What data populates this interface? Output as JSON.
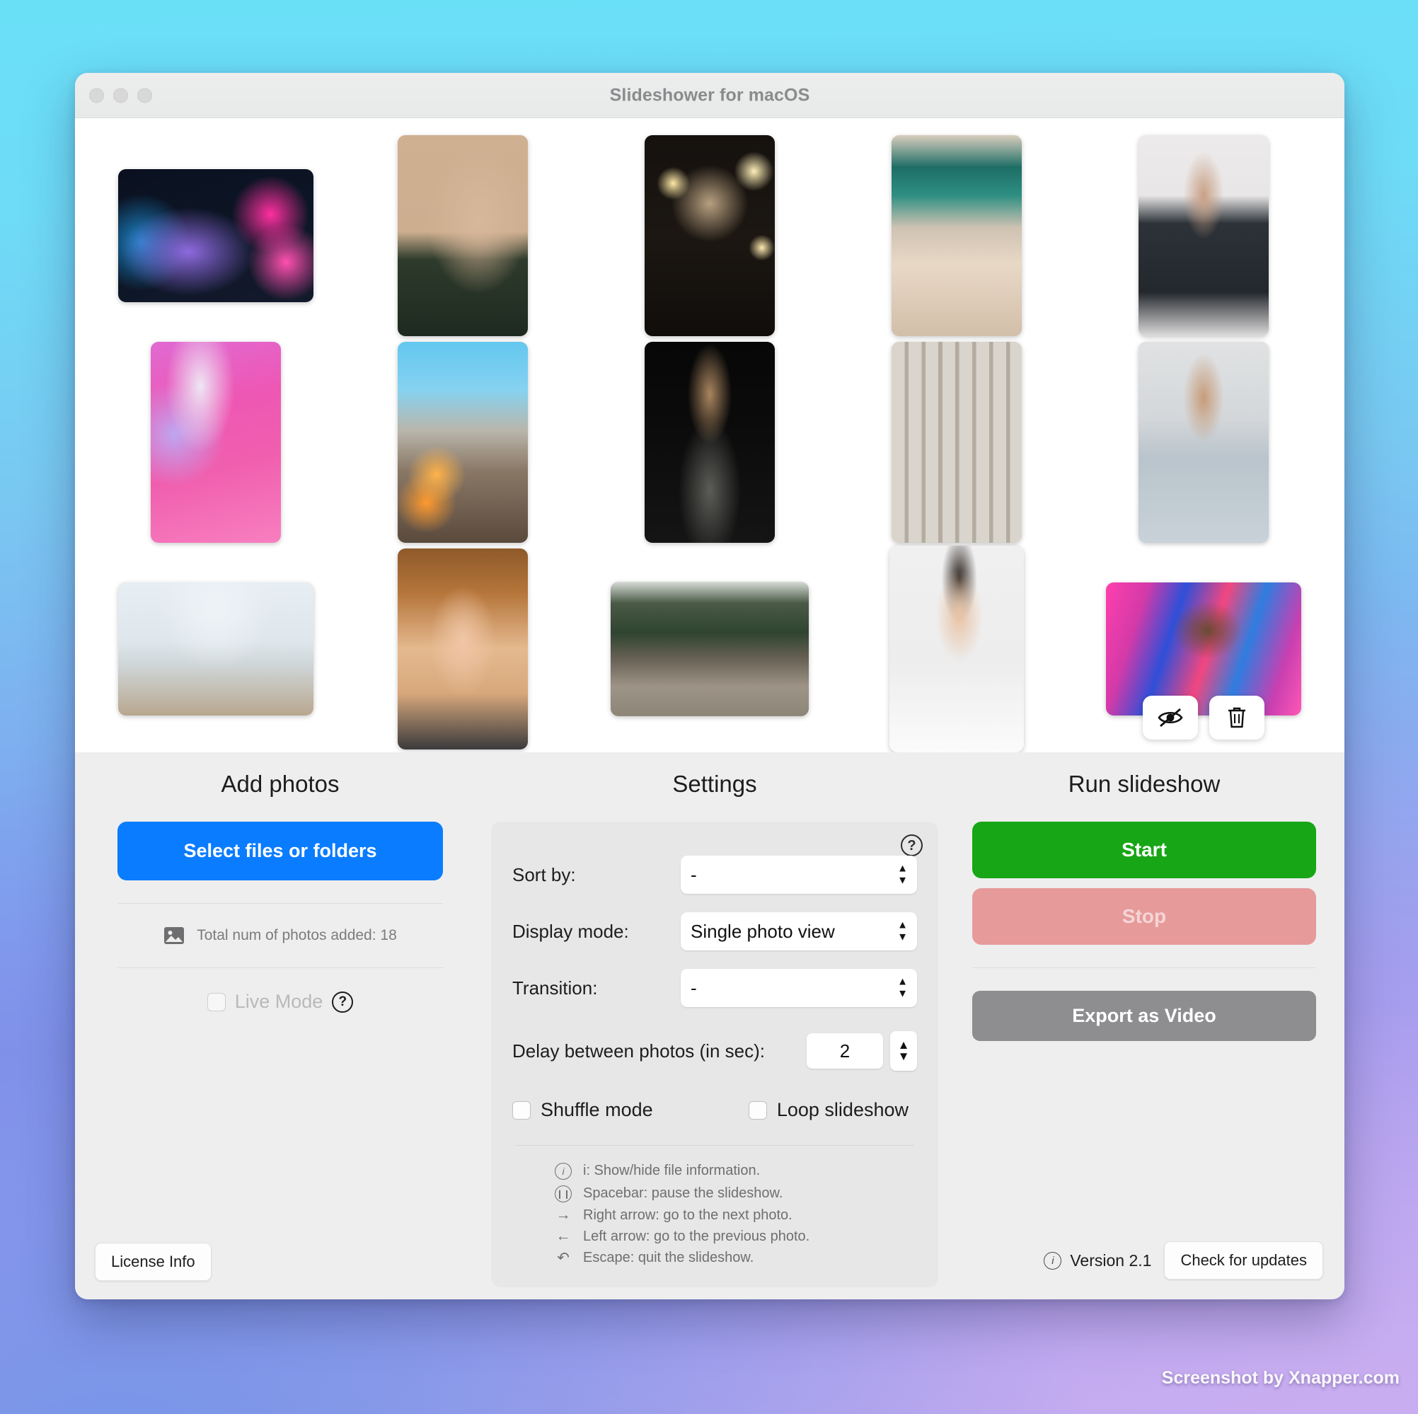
{
  "window": {
    "title": "Slideshower for macOS",
    "traffic_lights": [
      "close",
      "minimize",
      "zoom"
    ]
  },
  "photos": {
    "items": [
      {
        "id": 1,
        "orientation": "landscape",
        "desc": "man in neon-lit street at night"
      },
      {
        "id": 2,
        "orientation": "portrait",
        "desc": "woman in green bomber jacket, beige wall"
      },
      {
        "id": 3,
        "orientation": "portrait",
        "desc": "bearded man with glasses, bokeh lights"
      },
      {
        "id": 4,
        "orientation": "portrait",
        "desc": "woman with sunglasses making peace sign"
      },
      {
        "id": 5,
        "orientation": "portrait",
        "desc": "man with glasses, arms crossed, white wall"
      },
      {
        "id": 6,
        "orientation": "portrait",
        "desc": "woman in pink neon light"
      },
      {
        "id": 7,
        "orientation": "portrait",
        "desc": "woman on balcony over city at dusk"
      },
      {
        "id": 8,
        "orientation": "portrait",
        "desc": "man in grey knit on black background"
      },
      {
        "id": 9,
        "orientation": "portrait",
        "desc": "smiling woman with round sunglasses"
      },
      {
        "id": 10,
        "orientation": "portrait",
        "desc": "man seated in bright office"
      },
      {
        "id": 11,
        "orientation": "landscape",
        "desc": "group of friends laughing outdoors"
      },
      {
        "id": 12,
        "orientation": "portrait",
        "desc": "redhead woman with red lipstick"
      },
      {
        "id": 13,
        "orientation": "landscape",
        "desc": "three friends sitting on a rock"
      },
      {
        "id": 14,
        "orientation": "portrait",
        "desc": "woman in white tee, light background"
      },
      {
        "id": 15,
        "orientation": "landscape",
        "desc": "man in front of graffiti wall"
      }
    ],
    "hover_actions": [
      {
        "name": "hide-photo",
        "icon": "eye-slash-icon"
      },
      {
        "name": "delete-photo",
        "icon": "trash-icon"
      }
    ]
  },
  "add_photos": {
    "title": "Add photos",
    "select_button": "Select files or folders",
    "count_icon": "image-icon",
    "count_label": "Total num of photos added: 18",
    "live_mode_label": "Live Mode",
    "live_mode_checked": false,
    "live_mode_help_icon": "question-circle-icon"
  },
  "settings": {
    "title": "Settings",
    "help_icon": "question-circle-icon",
    "sort_by": {
      "label": "Sort by:",
      "value": "-"
    },
    "display_mode": {
      "label": "Display mode:",
      "value": "Single photo view"
    },
    "transition": {
      "label": "Transition:",
      "value": "-"
    },
    "delay": {
      "label": "Delay between photos (in sec):",
      "value": "2"
    },
    "shuffle": {
      "label": "Shuffle mode",
      "checked": false
    },
    "loop": {
      "label": "Loop slideshow",
      "checked": false
    },
    "hints": [
      {
        "icon": "info-circle-icon",
        "glyph": "i",
        "text": "i: Show/hide file information."
      },
      {
        "icon": "pause-circle-icon",
        "glyph": "II",
        "text": "Spacebar: pause the slideshow."
      },
      {
        "icon": "arrow-right-icon",
        "glyph": "→",
        "text": "Right arrow: go to the next photo."
      },
      {
        "icon": "arrow-left-icon",
        "glyph": "←",
        "text": "Left arrow: go to the previous photo."
      },
      {
        "icon": "escape-icon",
        "glyph": "↺",
        "text": "Escape: quit the slideshow."
      }
    ]
  },
  "run_slideshow": {
    "title": "Run slideshow",
    "start_label": "Start",
    "stop_label": "Stop",
    "export_label": "Export as Video"
  },
  "footer": {
    "license_label": "License Info",
    "version_icon": "info-circle-icon",
    "version_label": "Version 2.1",
    "updates_label": "Check for updates"
  },
  "watermark": "Screenshot by Xnapper.com",
  "colors": {
    "accent_blue": "#0a7cff",
    "start_green": "#17a616",
    "stop_red": "#e69a9a",
    "export_grey": "#8e8e90",
    "panel_grey": "#eeeeee",
    "card_grey": "#e7e7e7"
  }
}
